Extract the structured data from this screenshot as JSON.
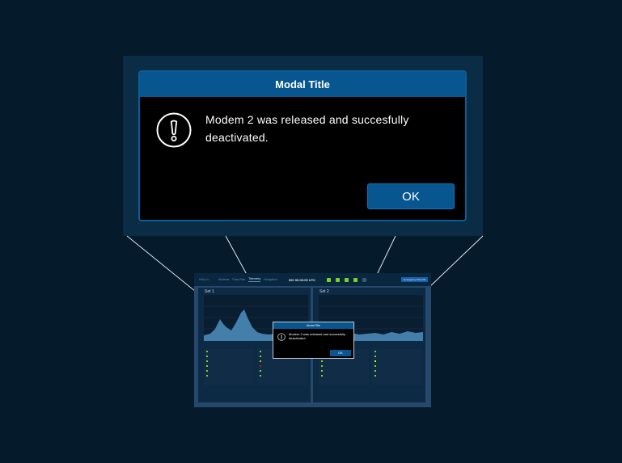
{
  "modal": {
    "title": "Modal Title",
    "message": "Modem 2 was released and succesfully deactivated.",
    "ok_label": "OK",
    "icon": "alert-circle-icon"
  },
  "mini_app": {
    "user": "Kelly Lu",
    "tabs": [
      "Modems",
      "Pass Plan",
      "Telemetry",
      "Navigation"
    ],
    "active_tab": "Telemetry",
    "clock": "000 00:00:00 UTC",
    "emergency_label": "Emergency Shut Off",
    "panels": [
      {
        "title": "Set 1"
      },
      {
        "title": "Set 2"
      }
    ]
  },
  "colors": {
    "background": "#051a2b",
    "modal_header": "#07568f",
    "status_green": "#7ed321"
  }
}
